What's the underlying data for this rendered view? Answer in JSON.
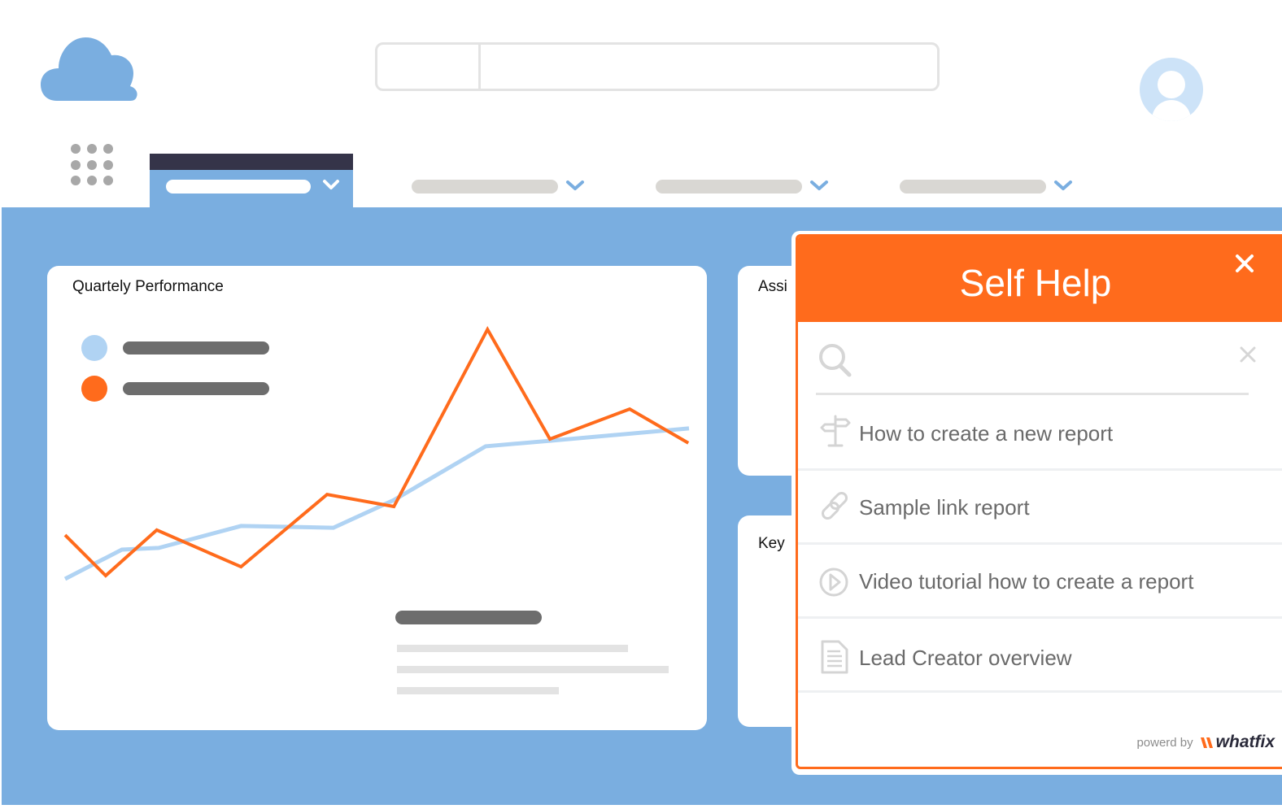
{
  "colors": {
    "brand_blue": "#7aaee0",
    "accent_orange": "#ff6b1c",
    "series_light_blue": "#b0d3f3",
    "dark_tab": "#353449",
    "placeholder_gray": "#d9d7d3"
  },
  "header": {
    "logo_icon": "cloud-icon",
    "apps_icon": "app-launcher-grid-icon",
    "avatar_icon": "user-avatar-icon",
    "search": {
      "value": "",
      "scope_value": ""
    }
  },
  "nav": {
    "tabs": [
      {
        "label": "",
        "active": true,
        "icon": "chevron-down-icon"
      },
      {
        "label": "",
        "active": false,
        "icon": "chevron-down-icon"
      },
      {
        "label": "",
        "active": false,
        "icon": "chevron-down-icon"
      },
      {
        "label": "",
        "active": false,
        "icon": "chevron-down-icon"
      }
    ]
  },
  "cards": {
    "main": {
      "title": "Quartely Performance"
    },
    "side1": {
      "title": "Assi"
    },
    "side2": {
      "title": "Key"
    }
  },
  "chart_data": {
    "type": "line",
    "title": "Quartely Performance",
    "xlabel": "",
    "ylabel": "",
    "grid": false,
    "legend": "top-left",
    "xlim": [
      0,
      100
    ],
    "ylim": [
      0,
      100
    ],
    "series": [
      {
        "name": "",
        "color": "#b0d3f3",
        "x": [
          0,
          9.1,
          15.0,
          28.2,
          43.0,
          52.7,
          67.4,
          77.7,
          100
        ],
        "y": [
          0,
          11.6,
          12.3,
          21.0,
          20.3,
          31.3,
          52.6,
          54.8,
          59.7
        ]
      },
      {
        "name": "",
        "color": "#ff6b1c",
        "x": [
          0,
          6.5,
          14.7,
          28.2,
          42.0,
          52.7,
          67.7,
          77.7,
          90.5,
          99.9
        ],
        "y": [
          17.4,
          1.3,
          19.4,
          4.8,
          33.5,
          28.7,
          99.0,
          55.5,
          67.4,
          53.9
        ]
      }
    ]
  },
  "self_help": {
    "title": "Self Help",
    "search": {
      "value": "",
      "placeholder": ""
    },
    "items": [
      {
        "label": "How to create a new report",
        "icon": "signpost-icon"
      },
      {
        "label": "Sample link report",
        "icon": "link-icon"
      },
      {
        "label": "Video tutorial how to create a report",
        "icon": "play-circle-icon"
      },
      {
        "label": "Lead Creator overview",
        "icon": "document-icon"
      }
    ],
    "footer": {
      "powered_by": "powerd by",
      "brand": "whatfix"
    }
  }
}
